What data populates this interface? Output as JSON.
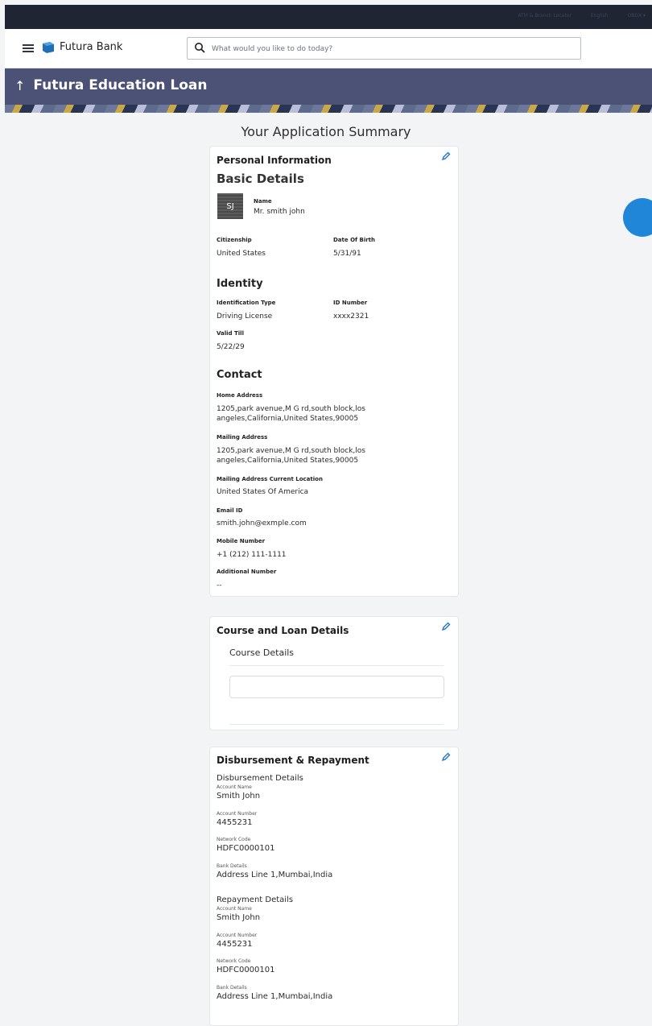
{
  "topbar": {
    "items": [
      "ATM & Branch Locator",
      "English",
      "OBDX ▾"
    ]
  },
  "header": {
    "brand": "Futura Bank",
    "search_placeholder": "What would you like to do today?"
  },
  "banner": {
    "back_icon": "arrow-up-icon",
    "title": "Futura Education Loan"
  },
  "page_title": "Your Application Summary",
  "personal": {
    "section_title": "Personal Information",
    "basic_heading": "Basic Details",
    "avatar_initials": "SJ",
    "name_label": "Name",
    "name_value": "Mr. smith john",
    "citizenship_label": "Citizenship",
    "citizenship_value": "United States",
    "dob_label": "Date Of Birth",
    "dob_value": "5/31/91",
    "identity_heading": "Identity",
    "id_type_label": "Identification Type",
    "id_type_value": "Driving License",
    "id_number_label": "ID Number",
    "id_number_value": "xxxx2321",
    "valid_till_label": "Valid Till",
    "valid_till_value": "5/22/29",
    "contact_heading": "Contact",
    "home_address_label": "Home Address",
    "home_address_value": "1205,park avenue,M G rd,south block,los angeles,California,United States,90005",
    "mailing_address_label": "Mailing Address",
    "mailing_address_value": "1205,park avenue,M G rd,south block,los angeles,California,United States,90005",
    "mailing_location_label": "Mailing Address Current Location",
    "mailing_location_value": "United States Of America",
    "email_label": "Email ID",
    "email_value": "smith.john@exmple.com",
    "mobile_label": "Mobile Number",
    "mobile_value": "+1 (212) 111-1111",
    "additional_label": "Additional Number",
    "additional_value": "--"
  },
  "course": {
    "section_title": "Course and Loan Details",
    "course_details_label": "Course Details"
  },
  "disbursement": {
    "section_title": "Disbursement & Repayment",
    "disb_heading": "Disbursement Details",
    "disb_account_name_label": "Account Name",
    "disb_account_name": "Smith John",
    "disb_account_number_label": "Account Number",
    "disb_account_number": "4455231",
    "disb_network_code_label": "Network Code",
    "disb_network_code": "HDFC0000101",
    "disb_bank_details_label": "Bank Details",
    "disb_bank_details": "Address Line 1,Mumbai,India",
    "rep_heading": "Repayment Details",
    "rep_account_name_label": "Account Name",
    "rep_account_name": "Smith John",
    "rep_account_number_label": "Account Number",
    "rep_account_number": "4455231",
    "rep_network_code_label": "Network Code",
    "rep_network_code": "HDFC0000101",
    "rep_bank_details_label": "Bank Details",
    "rep_bank_details": "Address Line 1,Mumbai,India"
  },
  "colors": {
    "banner": "#4b5275",
    "topbar": "#1f2533",
    "accent": "#1f86d8"
  }
}
